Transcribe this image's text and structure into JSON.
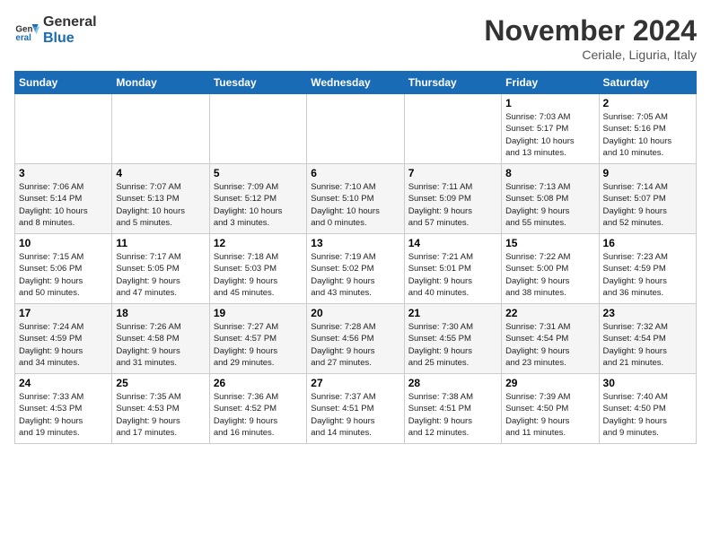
{
  "logo": {
    "line1": "General",
    "line2": "Blue"
  },
  "title": "November 2024",
  "location": "Ceriale, Liguria, Italy",
  "days_of_week": [
    "Sunday",
    "Monday",
    "Tuesday",
    "Wednesday",
    "Thursday",
    "Friday",
    "Saturday"
  ],
  "weeks": [
    [
      {
        "day": "",
        "info": ""
      },
      {
        "day": "",
        "info": ""
      },
      {
        "day": "",
        "info": ""
      },
      {
        "day": "",
        "info": ""
      },
      {
        "day": "",
        "info": ""
      },
      {
        "day": "1",
        "info": "Sunrise: 7:03 AM\nSunset: 5:17 PM\nDaylight: 10 hours\nand 13 minutes."
      },
      {
        "day": "2",
        "info": "Sunrise: 7:05 AM\nSunset: 5:16 PM\nDaylight: 10 hours\nand 10 minutes."
      }
    ],
    [
      {
        "day": "3",
        "info": "Sunrise: 7:06 AM\nSunset: 5:14 PM\nDaylight: 10 hours\nand 8 minutes."
      },
      {
        "day": "4",
        "info": "Sunrise: 7:07 AM\nSunset: 5:13 PM\nDaylight: 10 hours\nand 5 minutes."
      },
      {
        "day": "5",
        "info": "Sunrise: 7:09 AM\nSunset: 5:12 PM\nDaylight: 10 hours\nand 3 minutes."
      },
      {
        "day": "6",
        "info": "Sunrise: 7:10 AM\nSunset: 5:10 PM\nDaylight: 10 hours\nand 0 minutes."
      },
      {
        "day": "7",
        "info": "Sunrise: 7:11 AM\nSunset: 5:09 PM\nDaylight: 9 hours\nand 57 minutes."
      },
      {
        "day": "8",
        "info": "Sunrise: 7:13 AM\nSunset: 5:08 PM\nDaylight: 9 hours\nand 55 minutes."
      },
      {
        "day": "9",
        "info": "Sunrise: 7:14 AM\nSunset: 5:07 PM\nDaylight: 9 hours\nand 52 minutes."
      }
    ],
    [
      {
        "day": "10",
        "info": "Sunrise: 7:15 AM\nSunset: 5:06 PM\nDaylight: 9 hours\nand 50 minutes."
      },
      {
        "day": "11",
        "info": "Sunrise: 7:17 AM\nSunset: 5:05 PM\nDaylight: 9 hours\nand 47 minutes."
      },
      {
        "day": "12",
        "info": "Sunrise: 7:18 AM\nSunset: 5:03 PM\nDaylight: 9 hours\nand 45 minutes."
      },
      {
        "day": "13",
        "info": "Sunrise: 7:19 AM\nSunset: 5:02 PM\nDaylight: 9 hours\nand 43 minutes."
      },
      {
        "day": "14",
        "info": "Sunrise: 7:21 AM\nSunset: 5:01 PM\nDaylight: 9 hours\nand 40 minutes."
      },
      {
        "day": "15",
        "info": "Sunrise: 7:22 AM\nSunset: 5:00 PM\nDaylight: 9 hours\nand 38 minutes."
      },
      {
        "day": "16",
        "info": "Sunrise: 7:23 AM\nSunset: 4:59 PM\nDaylight: 9 hours\nand 36 minutes."
      }
    ],
    [
      {
        "day": "17",
        "info": "Sunrise: 7:24 AM\nSunset: 4:59 PM\nDaylight: 9 hours\nand 34 minutes."
      },
      {
        "day": "18",
        "info": "Sunrise: 7:26 AM\nSunset: 4:58 PM\nDaylight: 9 hours\nand 31 minutes."
      },
      {
        "day": "19",
        "info": "Sunrise: 7:27 AM\nSunset: 4:57 PM\nDaylight: 9 hours\nand 29 minutes."
      },
      {
        "day": "20",
        "info": "Sunrise: 7:28 AM\nSunset: 4:56 PM\nDaylight: 9 hours\nand 27 minutes."
      },
      {
        "day": "21",
        "info": "Sunrise: 7:30 AM\nSunset: 4:55 PM\nDaylight: 9 hours\nand 25 minutes."
      },
      {
        "day": "22",
        "info": "Sunrise: 7:31 AM\nSunset: 4:54 PM\nDaylight: 9 hours\nand 23 minutes."
      },
      {
        "day": "23",
        "info": "Sunrise: 7:32 AM\nSunset: 4:54 PM\nDaylight: 9 hours\nand 21 minutes."
      }
    ],
    [
      {
        "day": "24",
        "info": "Sunrise: 7:33 AM\nSunset: 4:53 PM\nDaylight: 9 hours\nand 19 minutes."
      },
      {
        "day": "25",
        "info": "Sunrise: 7:35 AM\nSunset: 4:53 PM\nDaylight: 9 hours\nand 17 minutes."
      },
      {
        "day": "26",
        "info": "Sunrise: 7:36 AM\nSunset: 4:52 PM\nDaylight: 9 hours\nand 16 minutes."
      },
      {
        "day": "27",
        "info": "Sunrise: 7:37 AM\nSunset: 4:51 PM\nDaylight: 9 hours\nand 14 minutes."
      },
      {
        "day": "28",
        "info": "Sunrise: 7:38 AM\nSunset: 4:51 PM\nDaylight: 9 hours\nand 12 minutes."
      },
      {
        "day": "29",
        "info": "Sunrise: 7:39 AM\nSunset: 4:50 PM\nDaylight: 9 hours\nand 11 minutes."
      },
      {
        "day": "30",
        "info": "Sunrise: 7:40 AM\nSunset: 4:50 PM\nDaylight: 9 hours\nand 9 minutes."
      }
    ]
  ]
}
